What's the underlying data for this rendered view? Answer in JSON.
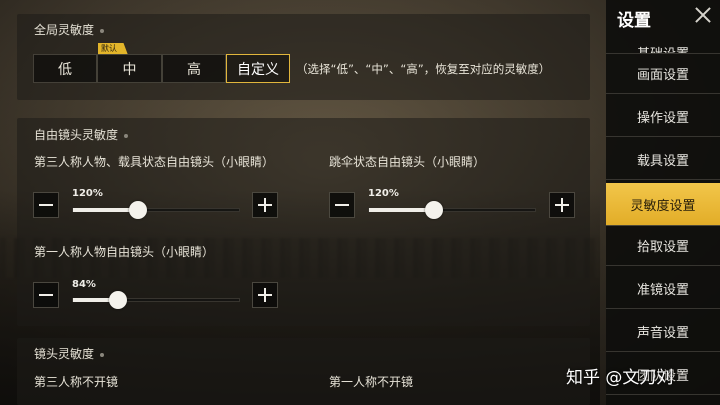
{
  "global_sensitivity": {
    "title": "全局灵敏度",
    "default_badge": "默认",
    "options": [
      "低",
      "中",
      "高",
      "自定义"
    ],
    "selected": "自定义",
    "hint": "（选择“低”、“中”、“高”，恢复至对应的灵敏度）"
  },
  "free_camera": {
    "title": "自由镜头灵敏度",
    "sliders": [
      {
        "label": "第三人称人物、载具状态自由镜头（小眼睛）",
        "value_text": "120%",
        "value": 0.27
      },
      {
        "label": "跳伞状态自由镜头（小眼睛）",
        "value_text": "120%",
        "value": 0.27
      },
      {
        "label": "第一人称人物自由镜头（小眼睛）",
        "value_text": "84%",
        "value": 0.19
      }
    ]
  },
  "camera_sensitivity": {
    "title": "镜头灵敏度",
    "items": [
      "第三人称不开镜",
      "第一人称不开镜"
    ]
  },
  "sidebar": {
    "title": "设置",
    "items": [
      {
        "label": "基础设置",
        "active": false
      },
      {
        "label": "画面设置",
        "active": false
      },
      {
        "label": "操作设置",
        "active": false
      },
      {
        "label": "载具设置",
        "active": false
      },
      {
        "label": "灵敏度设置",
        "active": true
      },
      {
        "label": "拾取设置",
        "active": false
      },
      {
        "label": "准镜设置",
        "active": false
      },
      {
        "label": "声音设置",
        "active": false
      },
      {
        "label": "团队设置",
        "active": false
      }
    ]
  },
  "watermark": "知乎 @文刀刘",
  "colors": {
    "accent": "#e2ad28",
    "sidebar_bg": "#0e0e0c"
  }
}
